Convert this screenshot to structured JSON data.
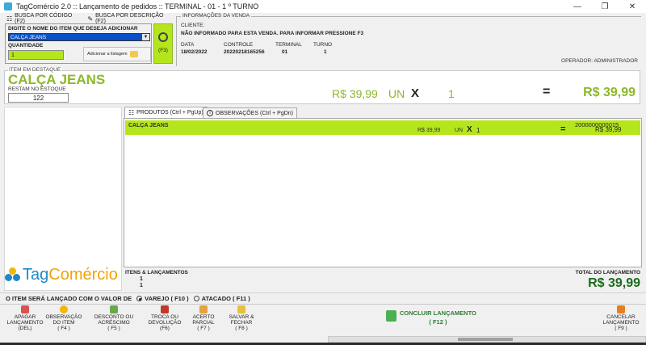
{
  "window": {
    "title": "TagComércio 2.0 :: Lançamento de pedidos :: TERMINAL - 01 - 1 º TURNO"
  },
  "search": {
    "tab_code": "BUSCA POR CÓDIGO (F2)",
    "tab_desc": "BUSCA POR DESCRIÇÃO (F2)",
    "prompt": "DIGITE O NOME DO ITEM QUE DESEJA ADICIONAR",
    "item_value": "CALÇA JEANS",
    "qty_label": "QUANTIDADE",
    "qty_value": "1",
    "add_label": "Adicionar a listagem",
    "f3_label": "(F3)"
  },
  "sale_info": {
    "group_label": "INFORMAÇÕES DA VENDA",
    "client_label": "CLIENTE:",
    "client_value": "NÃO INFORMADO PARA ESTA VENDA. PARA INFORMAR PRESSIONE F3",
    "date_label": "DATA",
    "date_value": "18/02/2022",
    "control_label": "CONTROLE",
    "control_value": "20220218165256",
    "terminal_label": "TERMINAL",
    "terminal_value": "01",
    "shift_label": "TURNO",
    "shift_value": "1",
    "operator": "OPERADOR: ADMINISTRADOR"
  },
  "highlight": {
    "group_label": "ITEM EM DESTAQUE",
    "name": "CALÇA JEANS",
    "stock_label": "RESTAM NO ESTOQUE",
    "stock_value": "122",
    "price": "R$ 39,99",
    "unit": "UN",
    "times": "X",
    "qty": "1",
    "equals": "=",
    "total": "R$ 39,99"
  },
  "tabs": {
    "products": "PRODUTOS (Ctrl + PgUp)",
    "notes": "OBSERVAÇÕES (Ctrl + PgDn)"
  },
  "items": [
    {
      "name": "CALÇA JEANS",
      "price": "R$ 39,99",
      "unit": "UN",
      "times": "X",
      "qty": "1",
      "equals": "=",
      "code": "2000000000015",
      "total": "R$ 39,99"
    }
  ],
  "summary": {
    "items_label": "ITENS & LANÇAMENTOS",
    "items_count": "1",
    "entries_count": "1",
    "total_label": "TOTAL DO LANÇAMENTO",
    "total_value": "R$ 39,99"
  },
  "brand": {
    "logo_text_a": "Tag",
    "logo_text_b": "Comércio"
  },
  "price_mode": {
    "label": "O ITEM SERÁ LANÇADO COM O VALOR DE",
    "retail": "VAREJO ( F10 )",
    "wholesale": "ATACADO ( F11 )"
  },
  "footer": {
    "delete": [
      "APAGAR",
      "LANÇAMENTO",
      "(DEL)"
    ],
    "note": [
      "OBSERVAÇÃO",
      "DO ITEM",
      "( F4 )"
    ],
    "discount": [
      "DESCONTO OU",
      "ACRÉSCIMO",
      "( F5 )"
    ],
    "exchange": [
      "TROCA OU",
      "DEVOLUÇÃO",
      "(F6)"
    ],
    "partial": [
      "ACERTO",
      "PARCIAL",
      "( F7 )"
    ],
    "save": [
      "SALVAR &",
      "FECHAR",
      "( F8 )"
    ],
    "conclude": "CONCLUIR LANÇAMENTO",
    "conclude_key": "( F12 )",
    "cancel": [
      "CANCELAR",
      "LANÇAMENTO",
      "( F9 )"
    ]
  },
  "colors": {
    "accent": "#b5e61d",
    "accent_text": "#8cb82a",
    "brand_blue": "#1e88c8",
    "brand_yellow": "#f2b705"
  }
}
